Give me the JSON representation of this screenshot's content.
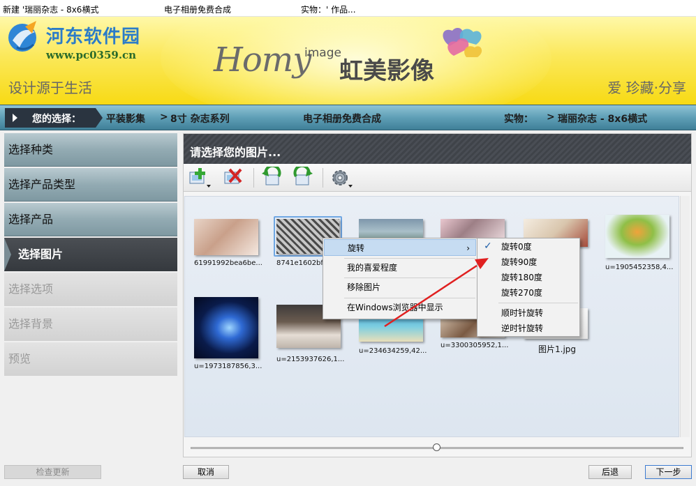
{
  "titlebar": {
    "title": "新建 '瑞丽杂志 - 8x6横式",
    "mid": "电子相册免费合成",
    "right": "实物：' 作品..."
  },
  "watermark": {
    "name": "河东软件园",
    "url": "www.pc0359.cn"
  },
  "brand": {
    "homy": "Homy",
    "image": "image",
    "cn": "虹美影像"
  },
  "slogan": "设计源于生活",
  "slogan_right": "爱  珍藏·分享",
  "breadcrumb": {
    "label": "您的选择：",
    "path1": "平装影集",
    "sep1": ">",
    "path2": "8寸 杂志系列",
    "service": "电子相册免费合成",
    "physical_label": "实物：",
    "sep2": ">",
    "physical_value": "瑞丽杂志 - 8x6横式"
  },
  "sidebar": {
    "items": [
      {
        "label": "选择种类",
        "state": "done"
      },
      {
        "label": "选择产品类型",
        "state": "done"
      },
      {
        "label": "选择产品",
        "state": "done"
      },
      {
        "label": "选择图片",
        "state": "active"
      },
      {
        "label": "选择选项",
        "state": "todo"
      },
      {
        "label": "选择背景",
        "state": "todo"
      },
      {
        "label": "预览",
        "state": "todo"
      }
    ]
  },
  "panel": {
    "title": "请选择您的图片..."
  },
  "toolbar": {
    "buttons": [
      {
        "icon": "add-image-icon"
      },
      {
        "icon": "delete-image-icon"
      },
      {
        "icon": "rotate-left-icon"
      },
      {
        "icon": "rotate-right-icon"
      },
      {
        "icon": "settings-gear-icon"
      }
    ]
  },
  "photos": [
    {
      "caption": "61991992bea6be..."
    },
    {
      "caption": "8741e1602bf3..."
    },
    {
      "caption": ""
    },
    {
      "caption": ""
    },
    {
      "caption": ""
    },
    {
      "caption": "u=1905452358,4..."
    },
    {
      "caption": "u=1973187856,3..."
    },
    {
      "caption": "u=2153937626,1..."
    },
    {
      "caption": "u=234634259,42..."
    },
    {
      "caption": "u=3300305952,1..."
    },
    {
      "caption": "图片1.jpg"
    }
  ],
  "context_menu": {
    "rotate": "旋转",
    "favorite": "我的喜爱程度",
    "remove": "移除图片",
    "show_in_explorer": "在Windows浏览器中显示"
  },
  "submenu": {
    "check": "✓",
    "rot0": "旋转0度",
    "rot90": "旋转90度",
    "rot180": "旋转180度",
    "rot270": "旋转270度",
    "cw": "顺时针旋转",
    "ccw": "逆时针旋转"
  },
  "footer": {
    "check_update": "检查更新",
    "cancel": "取消",
    "back": "后退",
    "next": "下一步"
  },
  "colors": {
    "accent_blue": "#3d7bd0",
    "arrow_red": "#e02020",
    "banner_yellow": "#f7da14",
    "crumb_teal": "#5f9fb6"
  }
}
